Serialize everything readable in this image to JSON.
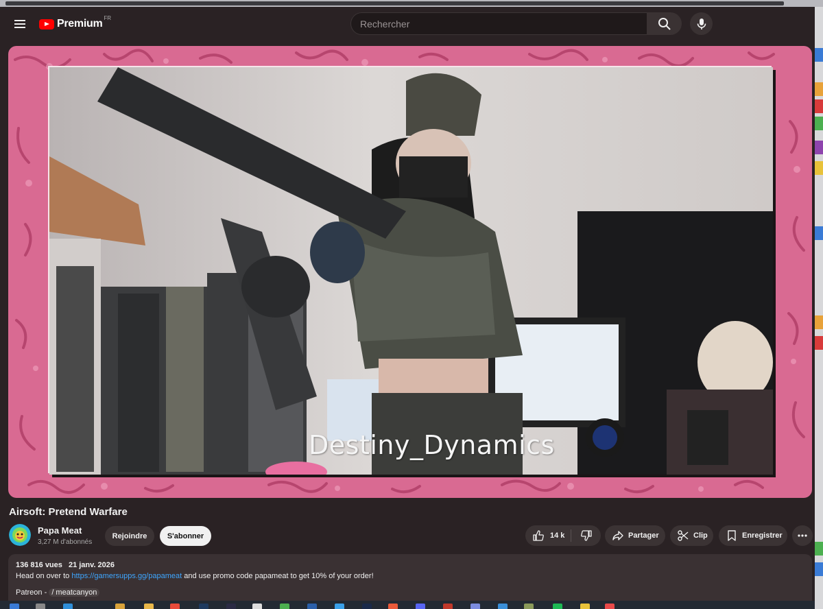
{
  "header": {
    "logo_text": "Premium",
    "logo_region": "FR",
    "search_placeholder": "Rechercher",
    "icons": [
      "menu-icon",
      "youtube-logo",
      "search-icon",
      "mic-icon"
    ]
  },
  "video": {
    "overlay_text": "Destiny_Dynamics"
  },
  "title": "Airsoft: Pretend Warfare",
  "channel": {
    "name": "Papa Meat",
    "subscribers": "3,27 M d'abonnés",
    "join_label": "Rejoindre",
    "subscribe_label": "S'abonner"
  },
  "actions": {
    "likes": "14 k",
    "share_label": "Partager",
    "clip_label": "Clip",
    "save_label": "Enregistrer"
  },
  "description": {
    "views": "136 816 vues",
    "date": "21 janv. 2026",
    "line_prefix": "Head on over to ",
    "link": "https://gamersupps.gg/papameat",
    "line_suffix": " and use promo code papameat to get 10% of your order!",
    "patreon_prefix": "Patreon - ",
    "patreon_handle": "/ meatcanyon"
  },
  "colors": {
    "background": "#2a2224",
    "accent_pink": "#d96a92",
    "link": "#3ea6ff",
    "brand_red": "#ff0000"
  }
}
